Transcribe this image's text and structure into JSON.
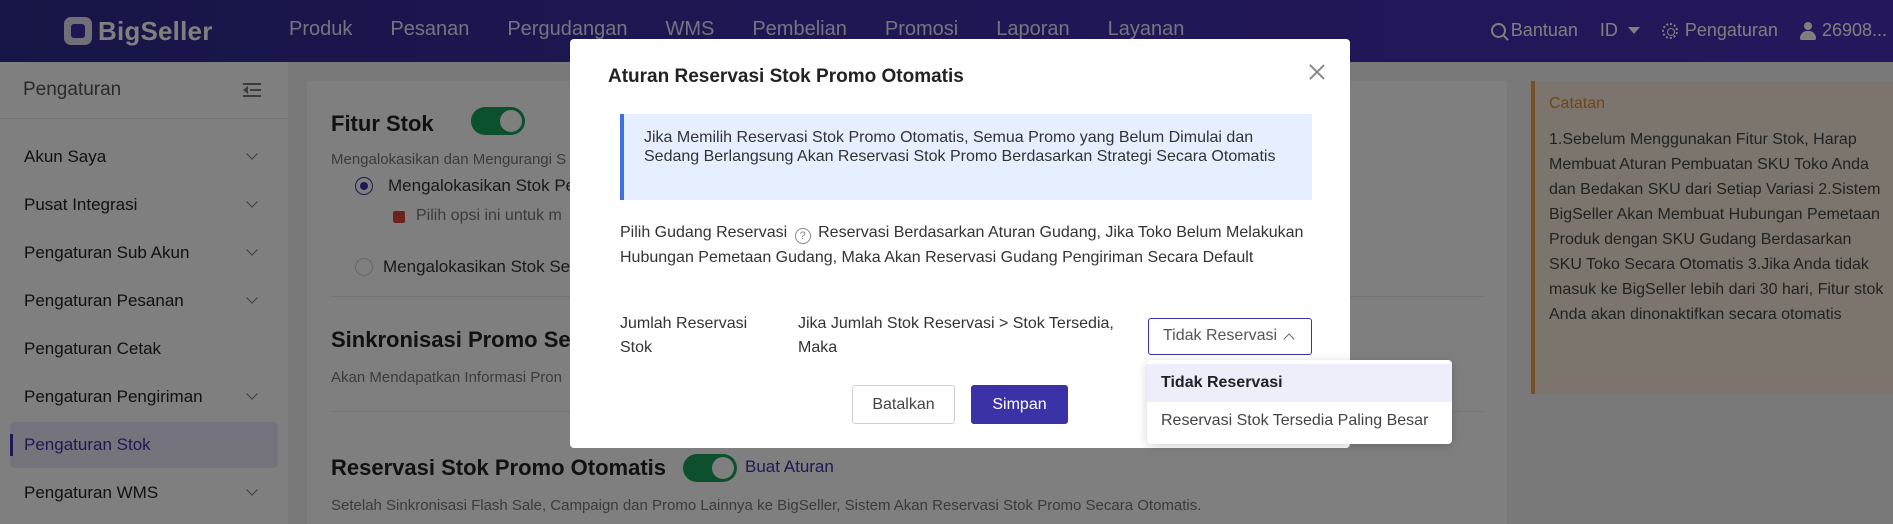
{
  "topbar": {
    "brand": "BigSeller",
    "nav": [
      "Produk",
      "Pesanan",
      "Pergudangan",
      "WMS",
      "Pembelian",
      "Promosi",
      "Laporan",
      "Layanan"
    ],
    "help": "Bantuan",
    "lang": "ID",
    "settings": "Pengaturan",
    "user": "26908..."
  },
  "sidebar": {
    "title": "Pengaturan",
    "items": [
      {
        "label": "Akun Saya",
        "expandable": true
      },
      {
        "label": "Pusat Integrasi",
        "expandable": true
      },
      {
        "label": "Pengaturan Sub Akun",
        "expandable": true
      },
      {
        "label": "Pengaturan Pesanan",
        "expandable": true
      },
      {
        "label": "Pengaturan Cetak",
        "expandable": false
      },
      {
        "label": "Pengaturan Pengiriman",
        "expandable": true
      },
      {
        "label": "Pengaturan Stok",
        "expandable": false,
        "active": true
      },
      {
        "label": "Pengaturan WMS",
        "expandable": true
      }
    ]
  },
  "main": {
    "fitur_stok": {
      "title": "Fitur Stok",
      "desc": "Mengalokasikan dan Mengurangi S",
      "radio1": "Mengalokasikan Stok Pe",
      "hint": "Pilih opsi ini untuk m",
      "radio2": "Mengalokasikan Stok Set"
    },
    "sinkronisasi": {
      "title": "Sinkronisasi Promo Seca",
      "desc": "Akan Mendapatkan Informasi Pron"
    },
    "reservasi": {
      "title": "Reservasi Stok Promo Otomatis",
      "link": "Buat Aturan",
      "desc": "Setelah Sinkronisasi Flash Sale, Campaign dan Promo Lainnya ke BigSeller, Sistem Akan Reservasi Stok Promo Secara Otomatis."
    }
  },
  "note": {
    "title": "Catatan",
    "body": "1.Sebelum Menggunakan Fitur Stok, Harap Membuat Aturan Pembuatan SKU Toko Anda dan Bedakan SKU dari Setiap Variasi 2.Sistem BigSeller Akan Membuat Hubungan Pemetaan Produk dengan SKU Gudang Berdasarkan SKU Toko Secara Otomatis 3.Jika Anda tidak masuk ke BigSeller lebih dari 30 hari, Fitur stok Anda akan dinonaktifkan secara otomatis"
  },
  "modal": {
    "title": "Aturan Reservasi Stok Promo Otomatis",
    "info": "Jika Memilih Reservasi Stok Promo Otomatis, Semua Promo yang Belum Dimulai dan Sedang Berlangsung Akan Reservasi Stok Promo Berdasarkan Strategi Secara Otomatis",
    "gudang_label": "Pilih Gudang Reservasi",
    "gudang_text": "Reservasi Berdasarkan Aturan Gudang, Jika Toko Belum Melakukan Hubungan Pemetaan Gudang, Maka Akan Reservasi Gudang Pengiriman Secara Default",
    "jumlah_label": "Jumlah Reservasi Stok",
    "condition": "Jika Jumlah Stok Reservasi > Stok Tersedia, Maka",
    "select_value": "Tidak Reservasi",
    "cancel": "Batalkan",
    "save": "Simpan",
    "options": [
      "Tidak Reservasi",
      "Reservasi Stok Tersedia Paling Besar"
    ]
  }
}
